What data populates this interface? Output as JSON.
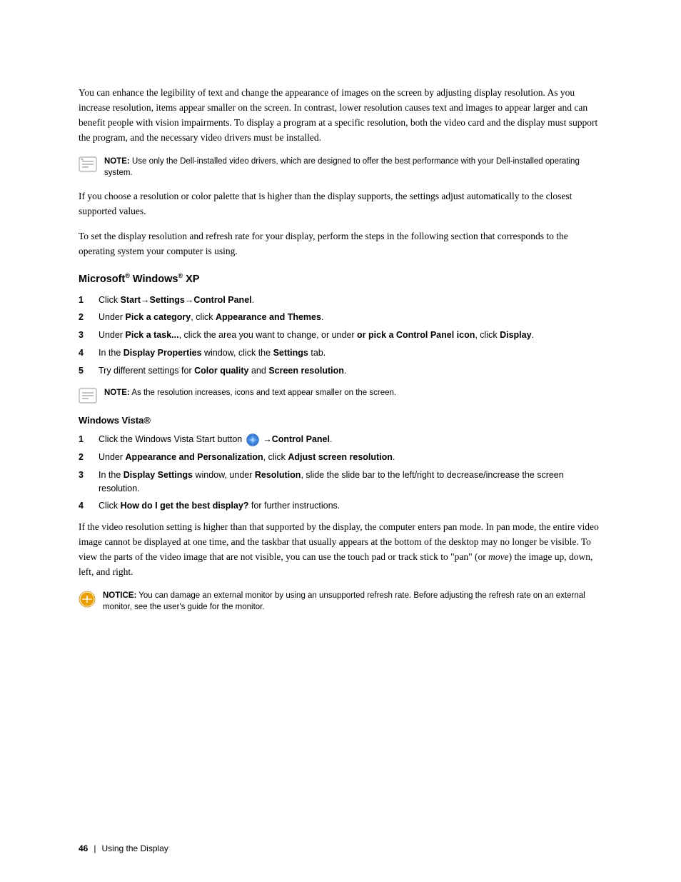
{
  "page": {
    "number": "46",
    "footer_separator": "|",
    "footer_section": "Using the Display"
  },
  "intro_paragraph": "You can enhance the legibility of text and change the appearance of images on the screen by adjusting display resolution. As you increase resolution, items appear smaller on the screen. In contrast, lower resolution causes text and images to appear larger and can benefit people with vision impairments. To display a program at a specific resolution, both the video card and the display must support the program, and the necessary video drivers must be installed.",
  "note1": {
    "label": "NOTE:",
    "text": "Use only the Dell-installed video drivers, which are designed to offer the best performance with your Dell-installed operating system."
  },
  "para2": "If you choose a resolution or color palette that is higher than the display supports, the settings adjust automatically to the closest supported values.",
  "para3": "To set the display resolution and refresh rate for your display, perform the steps in the following section that corresponds to the operating system your computer is using.",
  "section_windows_xp": {
    "heading_prefix": "Microsoft",
    "heading_sup1": "®",
    "heading_mid": " Windows",
    "heading_sup2": "®",
    "heading_suffix": " XP",
    "steps": [
      {
        "num": "1",
        "text_parts": [
          {
            "type": "text",
            "content": "Click "
          },
          {
            "type": "bold",
            "content": "Start"
          },
          {
            "type": "text",
            "content": "→"
          },
          {
            "type": "bold",
            "content": "Settings"
          },
          {
            "type": "text",
            "content": "→"
          },
          {
            "type": "bold",
            "content": "Control Panel"
          },
          {
            "type": "text",
            "content": "."
          }
        ]
      },
      {
        "num": "2",
        "text_parts": [
          {
            "type": "text",
            "content": "Under "
          },
          {
            "type": "bold",
            "content": "Pick a category"
          },
          {
            "type": "text",
            "content": ", click "
          },
          {
            "type": "bold",
            "content": "Appearance and Themes"
          },
          {
            "type": "text",
            "content": "."
          }
        ]
      },
      {
        "num": "3",
        "text_parts": [
          {
            "type": "text",
            "content": "Under "
          },
          {
            "type": "bold",
            "content": "Pick a task..."
          },
          {
            "type": "text",
            "content": ", click the area you want to change, or under "
          },
          {
            "type": "bold",
            "content": "or pick a Control Panel icon"
          },
          {
            "type": "text",
            "content": ", click "
          },
          {
            "type": "bold",
            "content": "Display"
          },
          {
            "type": "text",
            "content": "."
          }
        ]
      },
      {
        "num": "4",
        "text_parts": [
          {
            "type": "text",
            "content": "In the "
          },
          {
            "type": "bold",
            "content": "Display Properties"
          },
          {
            "type": "text",
            "content": " window, click the "
          },
          {
            "type": "bold",
            "content": "Settings"
          },
          {
            "type": "text",
            "content": " tab."
          }
        ]
      },
      {
        "num": "5",
        "text_parts": [
          {
            "type": "text",
            "content": "Try different settings for "
          },
          {
            "type": "bold",
            "content": "Color quality"
          },
          {
            "type": "text",
            "content": " and "
          },
          {
            "type": "bold",
            "content": "Screen resolution"
          },
          {
            "type": "text",
            "content": "."
          }
        ]
      }
    ]
  },
  "note2": {
    "label": "NOTE:",
    "text": "As the resolution increases, icons and text appear smaller on the screen."
  },
  "section_vista": {
    "heading": "Windows Vista®",
    "steps": [
      {
        "num": "1",
        "text_parts": [
          {
            "type": "text",
            "content": "Click the Windows Vista Start button "
          },
          {
            "type": "icon",
            "content": "vista-start-icon"
          },
          {
            "type": "text",
            "content": " →"
          },
          {
            "type": "bold",
            "content": "Control Panel"
          },
          {
            "type": "text",
            "content": "."
          }
        ]
      },
      {
        "num": "2",
        "text_parts": [
          {
            "type": "text",
            "content": "Under "
          },
          {
            "type": "bold",
            "content": "Appearance and Personalization"
          },
          {
            "type": "text",
            "content": ", click "
          },
          {
            "type": "bold",
            "content": "Adjust screen resolution"
          },
          {
            "type": "text",
            "content": "."
          }
        ]
      },
      {
        "num": "3",
        "text_parts": [
          {
            "type": "text",
            "content": "In the "
          },
          {
            "type": "bold",
            "content": "Display Settings"
          },
          {
            "type": "text",
            "content": " window, under "
          },
          {
            "type": "bold",
            "content": "Resolution"
          },
          {
            "type": "text",
            "content": ", slide the slide bar to the left/right to decrease/increase the screen resolution."
          }
        ]
      },
      {
        "num": "4",
        "text_parts": [
          {
            "type": "text",
            "content": "Click "
          },
          {
            "type": "bold",
            "content": "How do I get the best display?"
          },
          {
            "type": "text",
            "content": " for further instructions."
          }
        ]
      }
    ]
  },
  "pan_mode_para": "If the video resolution setting is higher than that supported by the display, the computer enters pan mode. In pan mode, the entire video image cannot be displayed at one time, and the taskbar that usually appears at the bottom of the desktop may no longer be visible. To view the parts of the video image that are not visible, you can use the touch pad or track stick to \"pan\" (or ",
  "pan_mode_italic": "move",
  "pan_mode_para2": ") the image up, down, left, and right.",
  "notice": {
    "label": "NOTICE:",
    "text": "You can damage an external monitor by using an unsupported refresh rate. Before adjusting the refresh rate on an external monitor, see the user's guide for the monitor."
  }
}
